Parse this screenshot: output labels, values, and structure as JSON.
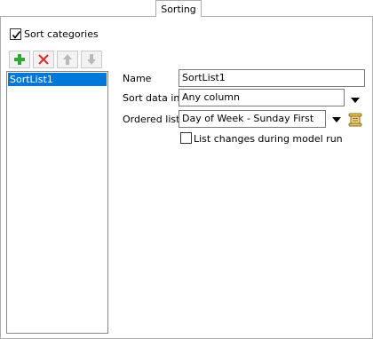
{
  "tab": {
    "label": "Sorting"
  },
  "sort_categories": {
    "label": "Sort categories",
    "checked": true
  },
  "toolbar": {
    "add_icon": "plus-icon",
    "delete_icon": "x-icon",
    "up_icon": "arrow-up-icon",
    "down_icon": "arrow-down-icon"
  },
  "list": {
    "items": [
      "SortList1"
    ],
    "selected": "SortList1"
  },
  "form": {
    "name_label": "Name",
    "name_value": "SortList1",
    "sort_data_label": "Sort data in",
    "sort_data_value": "Any column",
    "ordered_list_label": "Ordered list",
    "ordered_list_value": "Day of Week - Sunday First",
    "list_changes_label": "List changes during model run",
    "list_changes_checked": false
  },
  "colors": {
    "selection": "#0078d7",
    "add": "#2ea82e",
    "delete": "#e03030",
    "disabled": "#b9b9b9"
  }
}
